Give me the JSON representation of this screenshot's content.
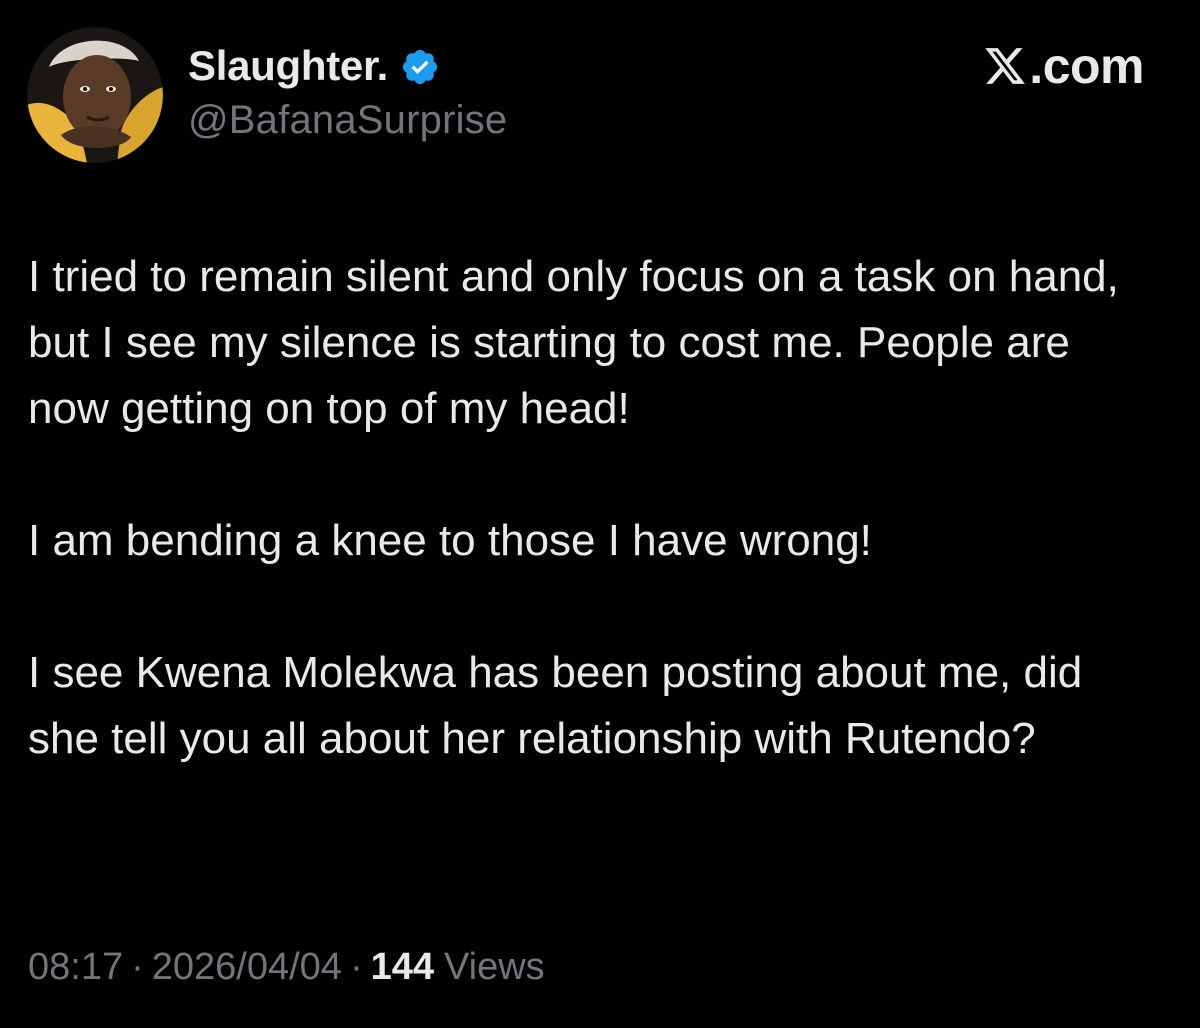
{
  "author": {
    "display_name": "Slaughter.",
    "handle": "@BafanaSurprise",
    "verified_icon": "verified-badge-icon",
    "avatar_icon": "profile-avatar"
  },
  "brand": {
    "text": ".com",
    "icon": "x-logo-icon"
  },
  "tweet": {
    "paragraphs": [
      "I tried to remain silent and only focus on a task on hand, but I see my silence is starting to cost me. People are now getting on top of my head!",
      "I am bending a knee to those I have wrong!",
      "I see Kwena Molekwa has been posting about me, did she tell you all about her relationship with Rutendo?"
    ]
  },
  "meta": {
    "time": "08:17",
    "separator": "·",
    "date": "2026/04/04",
    "views_count": "144",
    "views_label": "Views"
  },
  "colors": {
    "background": "#000000",
    "primary_text": "#e7e9ea",
    "secondary_text": "#71767b",
    "verified_blue": "#1d9bf0"
  }
}
